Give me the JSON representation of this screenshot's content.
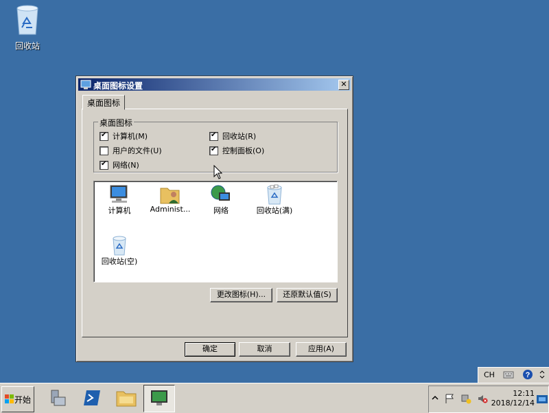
{
  "desktop": {
    "recycle_bin_label": "回收站"
  },
  "dialog": {
    "title": "桌面图标设置",
    "close": "✕",
    "tab": "桌面图标",
    "group_label": "桌面图标",
    "checkboxes": [
      {
        "label": "计算机(M)",
        "checked": true
      },
      {
        "label": "回收站(R)",
        "checked": true
      },
      {
        "label": "用户的文件(U)",
        "checked": false
      },
      {
        "label": "控制面板(O)",
        "checked": true
      },
      {
        "label": "网络(N)",
        "checked": true
      }
    ],
    "icons": [
      {
        "label": "计算机",
        "icon": "computer-icon"
      },
      {
        "label": "Administ...",
        "icon": "user-folder-icon"
      },
      {
        "label": "网络",
        "icon": "network-icon"
      },
      {
        "label": "回收站(满)",
        "icon": "recycle-bin-full-icon"
      },
      {
        "label": "回收站(空)",
        "icon": "recycle-bin-empty-icon"
      }
    ],
    "change_icon_btn": "更改图标(H)...",
    "restore_default_btn": "还原默认值(S)",
    "ok_btn": "确定",
    "cancel_btn": "取消",
    "apply_btn": "应用(A)"
  },
  "taskbar": {
    "start_label": "开始",
    "lang": "CH",
    "clock_time": "12:11",
    "clock_date": "2018/12/14"
  },
  "colors": {
    "desktop": "#3a6ea5",
    "titlebar_start": "#0a246a",
    "titlebar_end": "#a6caf0",
    "face": "#d4d0c8"
  }
}
